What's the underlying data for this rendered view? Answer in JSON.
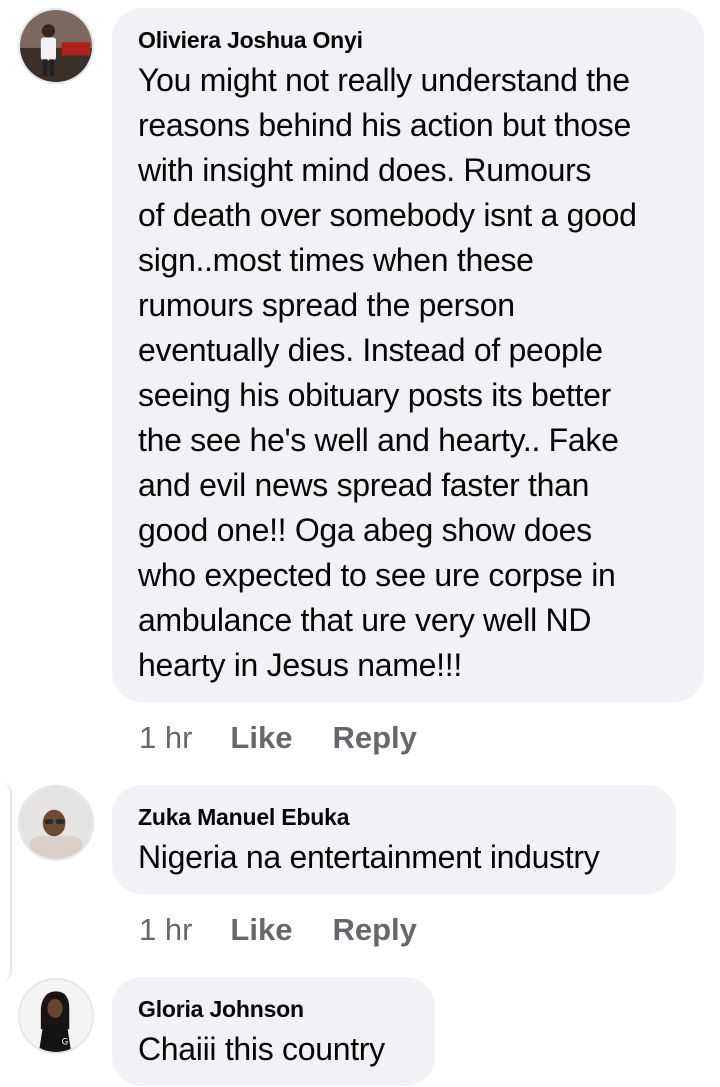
{
  "comments": [
    {
      "author": "Oliviera Joshua Onyi",
      "text": "You might not really understand the\nreasons behind his action but those\nwith insight mind does.  Rumours\nof death over somebody isnt a good\nsign..most times when these\nrumours spread the person\neventually dies. Instead of people\nseeing his obituary posts its better\nthe see he's well and hearty.. Fake\nand evil news spread faster than\ngood one!! Oga abeg show does\nwho expected to see ure corpse in\nambulance that ure very well ND\nhearty in Jesus name!!!",
      "time": "1 hr",
      "like_label": "Like",
      "reply_label": "Reply"
    },
    {
      "author": "Zuka Manuel Ebuka",
      "text": "Nigeria na entertainment industry",
      "time": "1 hr",
      "like_label": "Like",
      "reply_label": "Reply"
    },
    {
      "author": "Gloria Johnson",
      "text": "Chaiii this country"
    }
  ]
}
